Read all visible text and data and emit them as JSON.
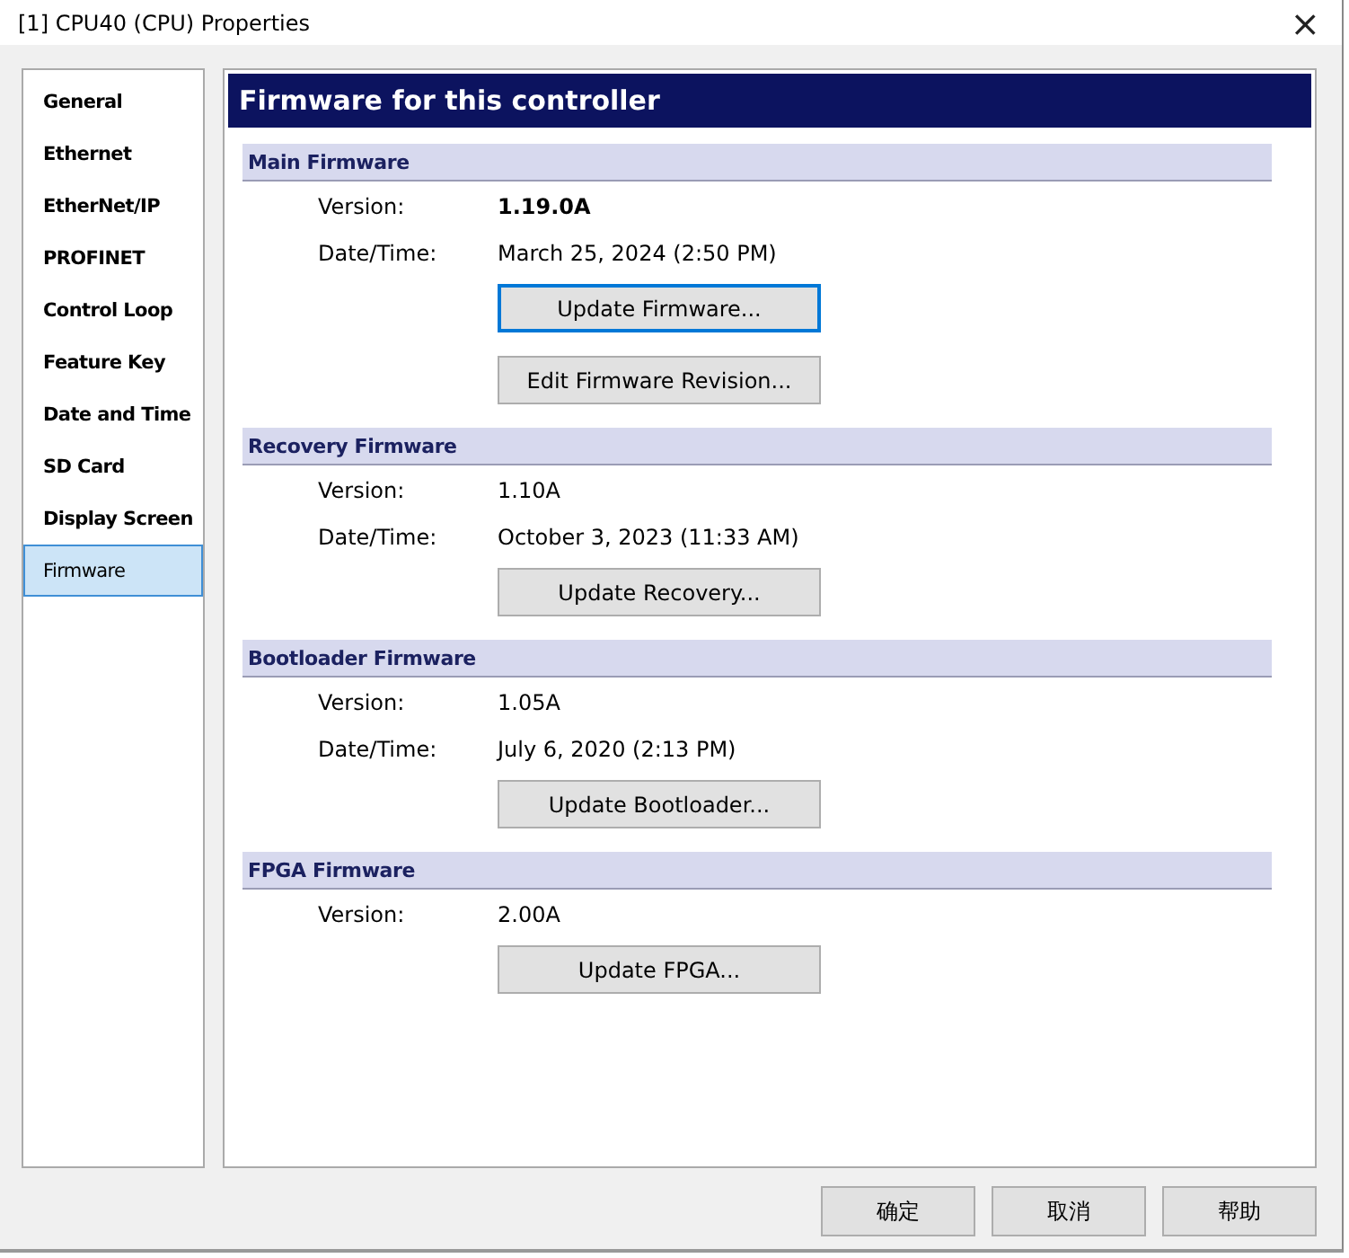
{
  "window": {
    "title": "[1] CPU40 (CPU) Properties",
    "close": "×"
  },
  "sidebar": {
    "items": [
      {
        "label": "General",
        "selected": false
      },
      {
        "label": "Ethernet",
        "selected": false
      },
      {
        "label": "EtherNet/IP",
        "selected": false
      },
      {
        "label": "PROFINET",
        "selected": false
      },
      {
        "label": "Control Loop",
        "selected": false
      },
      {
        "label": "Feature Key",
        "selected": false
      },
      {
        "label": "Date and Time",
        "selected": false
      },
      {
        "label": "SD Card",
        "selected": false
      },
      {
        "label": "Display Screen",
        "selected": false
      },
      {
        "label": "Firmware",
        "selected": true
      }
    ]
  },
  "panel": {
    "title": "Firmware for this controller",
    "sections": [
      {
        "title": "Main Firmware",
        "fields": [
          {
            "label": "Version:",
            "value": "1.19.0A",
            "emphasis": true
          },
          {
            "label": "Date/Time:",
            "value": "March 25, 2024 (2:50 PM)",
            "emphasis": false
          }
        ],
        "buttons": [
          {
            "label": "Update Firmware...",
            "focused": true
          },
          {
            "label": "Edit Firmware Revision...",
            "focused": false
          }
        ]
      },
      {
        "title": "Recovery Firmware",
        "fields": [
          {
            "label": "Version:",
            "value": "1.10A",
            "emphasis": false
          },
          {
            "label": "Date/Time:",
            "value": "October 3, 2023 (11:33 AM)",
            "emphasis": false
          }
        ],
        "buttons": [
          {
            "label": "Update Recovery...",
            "focused": false
          }
        ]
      },
      {
        "title": "Bootloader Firmware",
        "fields": [
          {
            "label": "Version:",
            "value": "1.05A",
            "emphasis": false
          },
          {
            "label": "Date/Time:",
            "value": "July 6, 2020 (2:13 PM)",
            "emphasis": false
          }
        ],
        "buttons": [
          {
            "label": "Update Bootloader...",
            "focused": false
          }
        ]
      },
      {
        "title": "FPGA Firmware",
        "fields": [
          {
            "label": "Version:",
            "value": "2.00A",
            "emphasis": false
          }
        ],
        "buttons": [
          {
            "label": "Update FPGA...",
            "focused": false
          }
        ]
      }
    ]
  },
  "buttons": [
    "确定",
    "取消",
    "帮助"
  ]
}
